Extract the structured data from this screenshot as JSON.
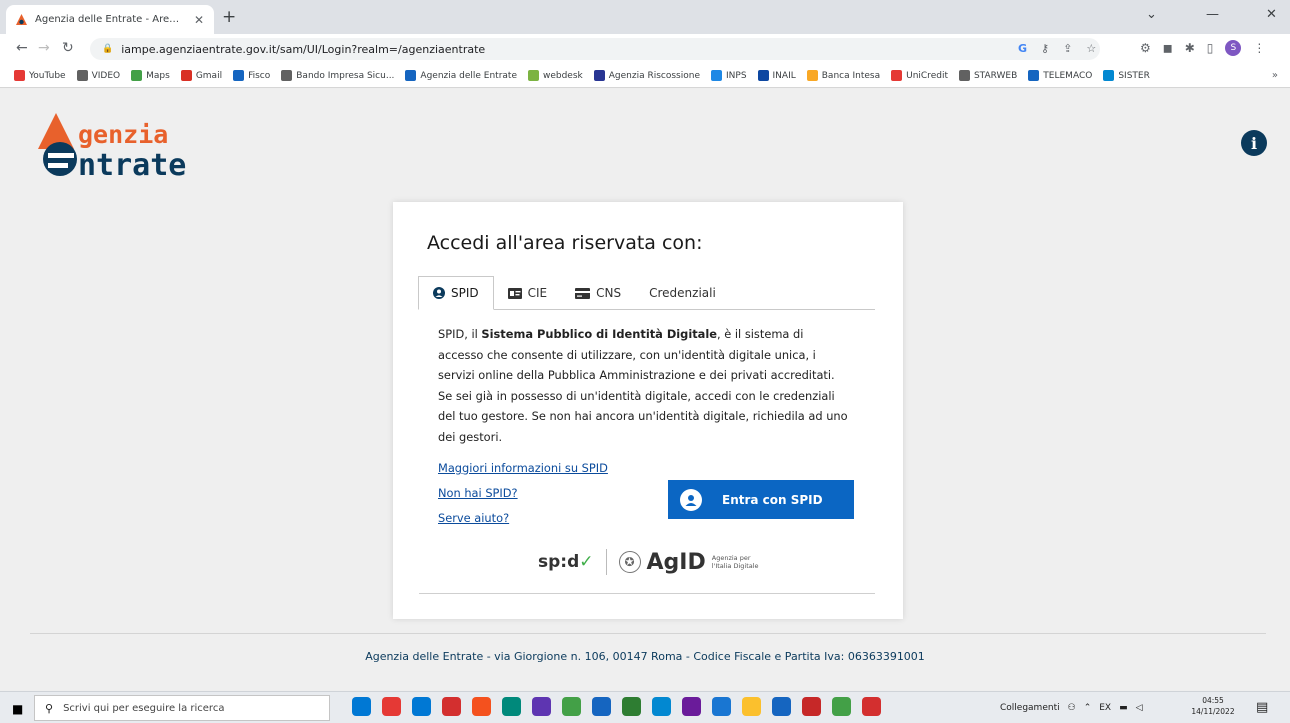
{
  "browser": {
    "tab_title": "Agenzia delle Entrate - Area riser",
    "new_tab": "+",
    "url": "iampe.agenziaentrate.gov.it/sam/UI/Login?realm=/agenziaentrate",
    "bookmarks": [
      {
        "label": "YouTube",
        "color": "#e53935"
      },
      {
        "label": "VIDEO",
        "color": "#616161"
      },
      {
        "label": "Maps",
        "color": "#43a047"
      },
      {
        "label": "Gmail",
        "color": "#d93025"
      },
      {
        "label": "Fisco",
        "color": "#1565c0"
      },
      {
        "label": "Bando Impresa Sicu...",
        "color": "#616161"
      },
      {
        "label": "Agenzia delle Entrate",
        "color": "#1565c0"
      },
      {
        "label": "webdesk",
        "color": "#7cb342"
      },
      {
        "label": "Agenzia Riscossione",
        "color": "#283593"
      },
      {
        "label": "INPS",
        "color": "#1e88e5"
      },
      {
        "label": "INAIL",
        "color": "#0d47a1"
      },
      {
        "label": "Banca Intesa",
        "color": "#f9a825"
      },
      {
        "label": "UniCredit",
        "color": "#e53935"
      },
      {
        "label": "STARWEB",
        "color": "#616161"
      },
      {
        "label": "TELEMACO",
        "color": "#1565c0"
      },
      {
        "label": "SISTER",
        "color": "#0288d1"
      }
    ],
    "bookmarks_more": "»"
  },
  "header": {
    "logo_line1": "genzia",
    "logo_line2": "ntrate",
    "accent": "#e8612c",
    "brand_blue": "#0b3a5c"
  },
  "card": {
    "title": "Accedi all'area riservata con:",
    "tabs": [
      {
        "label": "SPID"
      },
      {
        "label": "CIE"
      },
      {
        "label": "CNS"
      },
      {
        "label": "Credenziali"
      }
    ],
    "desc_1": "SPID, il ",
    "desc_bold": "Sistema Pubblico di Identità Digitale",
    "desc_2": ", è il sistema di accesso che consente di utilizzare, con un'identità digitale unica, i servizi online della Pubblica Amministrazione e dei privati accreditati. Se sei già in possesso di un'identità digitale, accedi con le credenziali del tuo gestore. Se non hai ancora un'identità digitale, richiedila ad uno dei gestori.",
    "links": [
      "Maggiori informazioni su SPID",
      "Non hai SPID?",
      "Serve aiuto?"
    ],
    "spid_button": "Entra con SPID",
    "spid_logo": "sp:d",
    "agid_logo": "AgID",
    "agid_sub": "Agenzia per l'Italia Digitale"
  },
  "footer": {
    "text": "Agenzia delle Entrate - via Giorgione n. 106, 00147 Roma - Codice Fiscale e Partita Iva: 06363391001"
  },
  "taskbar": {
    "search_placeholder": "Scrivi qui per eseguire la ricerca",
    "links_label": "Collegamenti",
    "lang": "EX",
    "time": "04:55",
    "date": "14/11/2022",
    "apps": [
      "#0078d4",
      "#e53935",
      "#0078d4",
      "#d32f2f",
      "#f4511e",
      "#00897b",
      "#5e35b1",
      "#43a047",
      "#1565c0",
      "#2e7d32",
      "#0288d1",
      "#6a1b9a",
      "#1976d2",
      "#fbc02d",
      "#1565c0",
      "#c62828",
      "#43a047",
      "#d32f2f"
    ]
  }
}
